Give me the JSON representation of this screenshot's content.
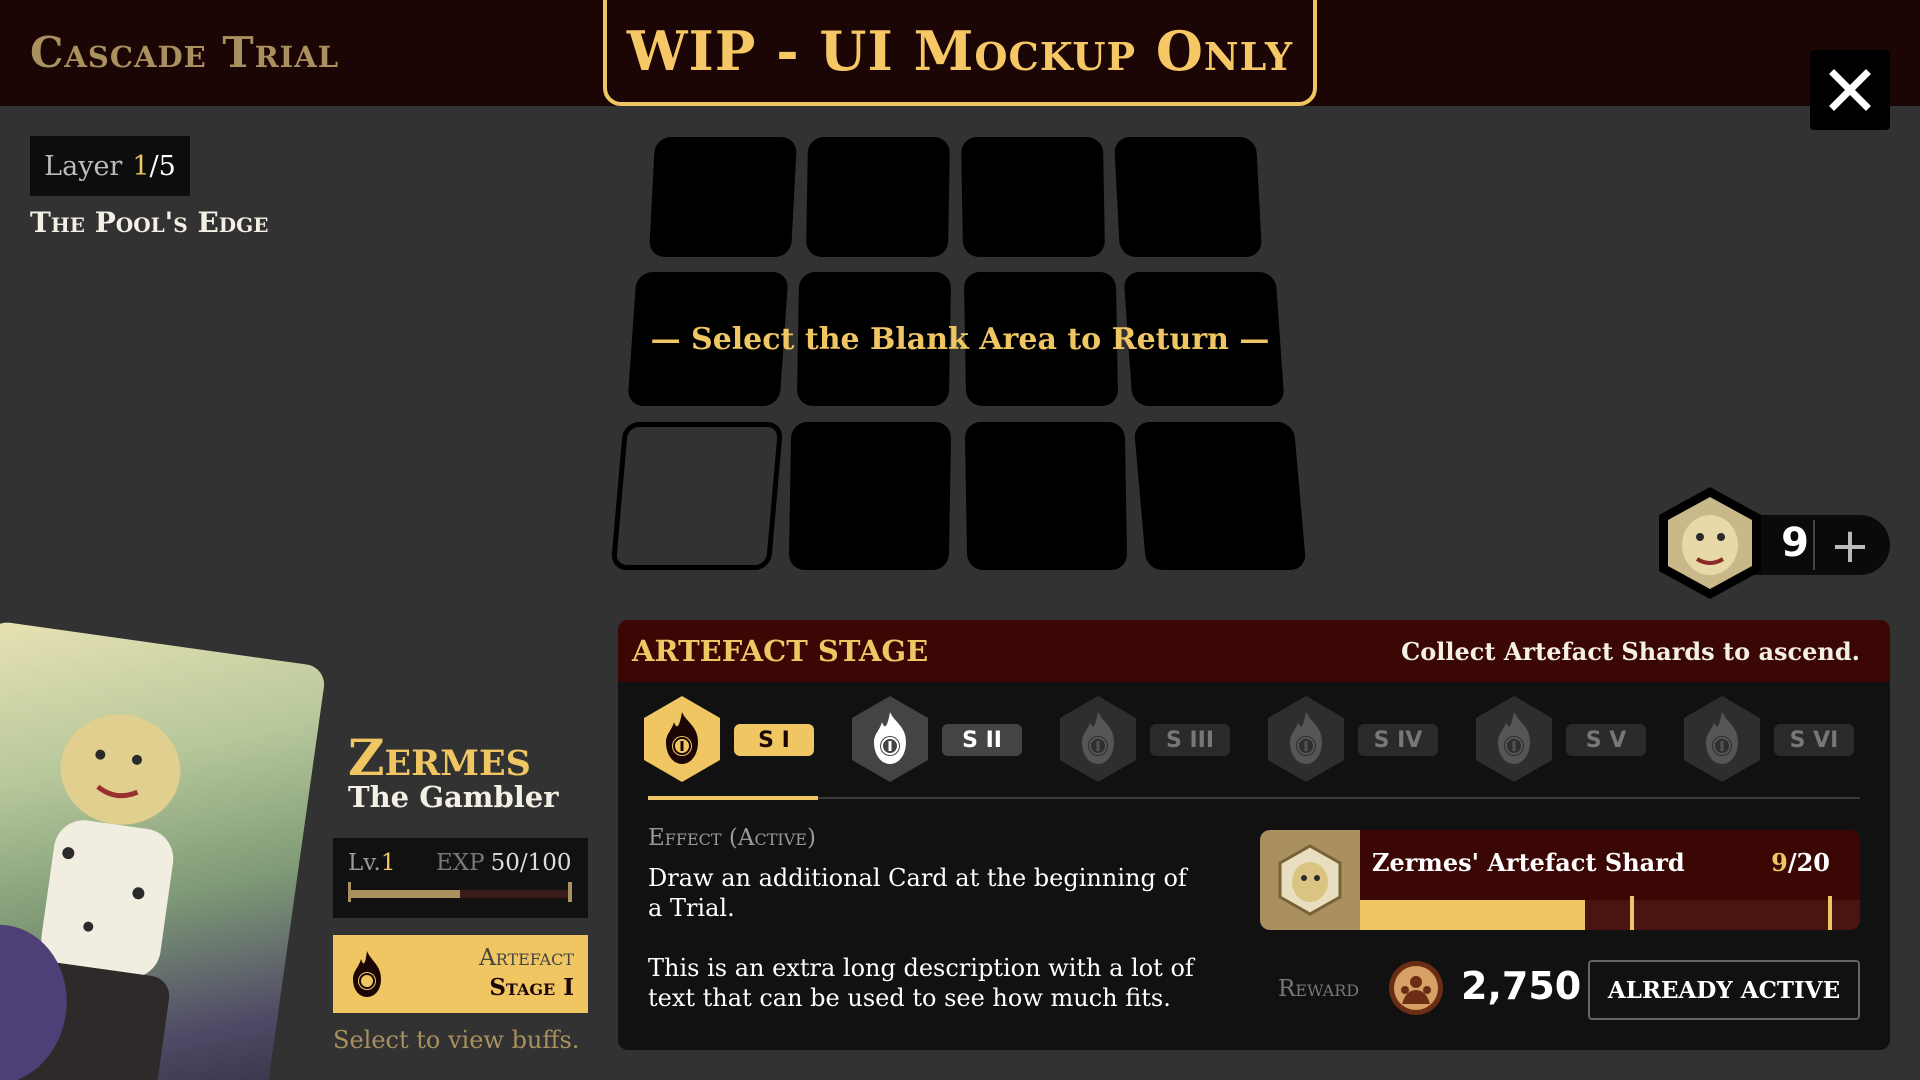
{
  "header": {
    "game_title": "Cascade Trial",
    "wip_banner": "WIP - UI Mockup Only"
  },
  "layer": {
    "label": "Layer",
    "current": "1",
    "total": "/5",
    "name": "The Pool's Edge"
  },
  "board": {
    "return_hint": "— Select the Blank Area to Return —"
  },
  "card_count": {
    "value": "9",
    "add_icon": "+"
  },
  "character": {
    "name": "Zermes",
    "title": "The Gambler",
    "level_label": "Lv.",
    "level": "1",
    "exp_label": "EXP",
    "exp_value": "50/100",
    "exp_fraction": 0.5,
    "artefact_line1": "Artefact",
    "artefact_line2": "Stage I",
    "buff_hint": "Select to view buffs."
  },
  "artefact_panel": {
    "title": "ARTEFACT STAGE",
    "subtitle": "Collect Artefact Shards to ascend.",
    "stages": [
      {
        "label": "S I",
        "state": "active"
      },
      {
        "label": "S II",
        "state": "next"
      },
      {
        "label": "S III",
        "state": "locked"
      },
      {
        "label": "S IV",
        "state": "locked"
      },
      {
        "label": "S V",
        "state": "locked"
      },
      {
        "label": "S VI",
        "state": "locked"
      }
    ],
    "effect_label": "Effect (Active)",
    "effect_text": "Draw an additional Card at the beginning of a Trial.",
    "effect_text_extra": "This is an extra long description with a lot of text that can be used to see how much fits.",
    "shard": {
      "name": "Zermes' Artefact Shard",
      "current": "9",
      "required": "/20",
      "fraction": 0.45
    },
    "reward_label": "Reward",
    "reward_value": "2,750",
    "action_button": "ALREADY ACTIVE"
  },
  "colors": {
    "accent": "#f0c662",
    "header_bg": "#1c0605",
    "panel_header": "#3a0705"
  },
  "icons": {
    "close": "close-icon",
    "flame_artefact": "flame-artefact-icon",
    "coin": "reward-coin-icon",
    "plus": "plus-icon"
  }
}
